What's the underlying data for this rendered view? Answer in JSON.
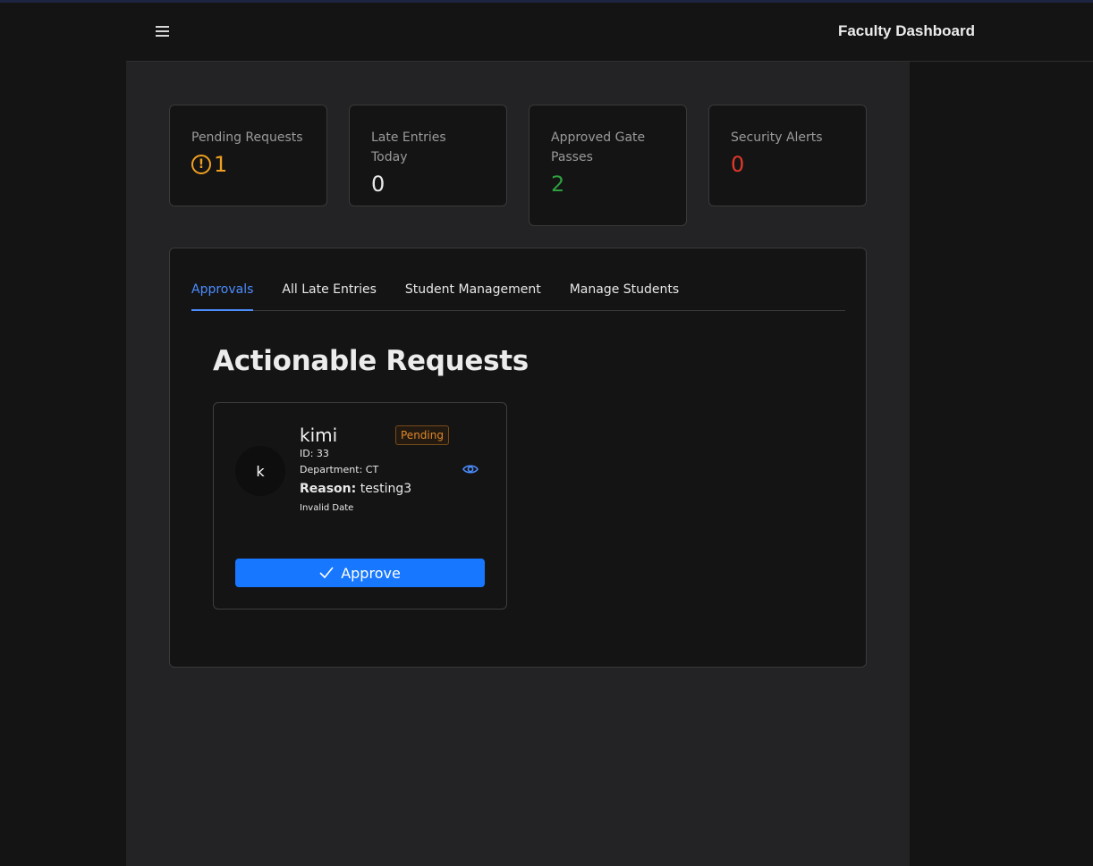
{
  "header": {
    "title": "Faculty Dashboard",
    "menu_icon": "hamburger-menu-icon"
  },
  "stats": [
    {
      "label": "Pending Requests",
      "value": "1",
      "color": "#f0a020",
      "icon": "exclamation-circle-icon"
    },
    {
      "label": "Late Entries Today",
      "value": "0",
      "color": "#e8e8e8"
    },
    {
      "label": "Approved Gate Passes",
      "value": "2",
      "color": "#2e9e3e"
    },
    {
      "label": "Security Alerts",
      "value": "0",
      "color": "#e0392b"
    }
  ],
  "tabs": [
    {
      "label": "Approvals",
      "active": true
    },
    {
      "label": "All Late Entries",
      "active": false
    },
    {
      "label": "Student Management",
      "active": false
    },
    {
      "label": "Manage Students",
      "active": false
    }
  ],
  "section_title": "Actionable Requests",
  "request": {
    "avatar_letter": "k",
    "name": "kimi",
    "status": "Pending",
    "id_text": "ID: 33",
    "department_text": "Department: CT",
    "reason_label": "Reason:",
    "reason_value": "testing3",
    "date_text": "Invalid Date",
    "approve_label": "Approve",
    "view_icon": "eye-icon"
  },
  "colors": {
    "accent": "#1777ff",
    "tab_active": "#4c8dff",
    "pending": "#e0862a"
  }
}
